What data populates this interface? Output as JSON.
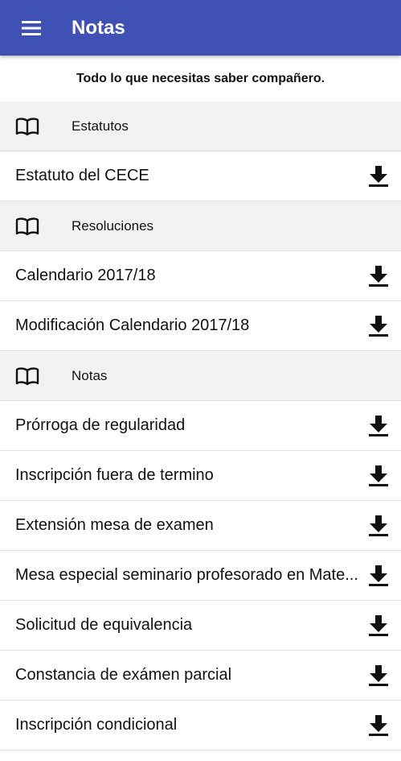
{
  "appbar": {
    "title": "Notas",
    "menu_icon": "hamburger-menu-icon",
    "color": "#3f51b5"
  },
  "subtitle": "Todo lo que necesitas saber compañero.",
  "sections": [
    {
      "title": "Estatutos",
      "icon": "book-icon",
      "items": [
        "Estatuto del CECE"
      ]
    },
    {
      "title": "Resoluciones",
      "icon": "book-icon",
      "items": [
        "Calendario 2017/18",
        "Modificación Calendario 2017/18"
      ]
    },
    {
      "title": "Notas",
      "icon": "book-icon",
      "items": [
        "Prórroga de regularidad",
        "Inscripción fuera de termino",
        "Extensión mesa de examen",
        "Mesa especial seminario profesorado en Mate...",
        "Solicitud de equivalencia",
        "Constancia de exámen parcial",
        "Inscripción condicional"
      ]
    }
  ],
  "download_icon": "download-icon"
}
